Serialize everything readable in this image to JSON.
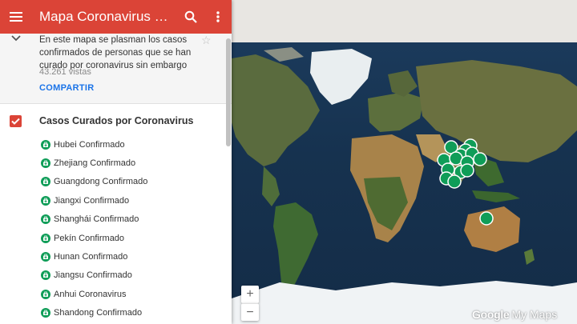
{
  "header": {
    "title": "Mapa Coronavirus Curados",
    "menu_icon": "menu-icon",
    "search_icon": "search-icon",
    "more_icon": "more-vert-icon",
    "color": "#db4437"
  },
  "info": {
    "description": "En este mapa se plasman los casos confirmados de personas que se han curado por coronavirus sin embargo",
    "views": "43.261 vistas",
    "share_label": "COMPARTIR"
  },
  "layer": {
    "title": "Casos Curados por Coronavirus",
    "checked": true,
    "pin_color": "#0f9d58",
    "items": [
      {
        "label": "Hubei Confirmado"
      },
      {
        "label": "Zhejiang Confirmado"
      },
      {
        "label": "Guangdong Confirmado"
      },
      {
        "label": "Jiangxi Confirmado"
      },
      {
        "label": "Shanghái Confirmado"
      },
      {
        "label": "Pekín Confirmado"
      },
      {
        "label": "Hunan Confirmado"
      },
      {
        "label": "Jiangsu Confirmado"
      },
      {
        "label": "Anhui Coronavirus"
      },
      {
        "label": "Shandong Confirmado"
      }
    ]
  },
  "map": {
    "zoom_in": "+",
    "zoom_out": "−",
    "watermark_brand": "Google",
    "watermark_product": "My Maps"
  }
}
